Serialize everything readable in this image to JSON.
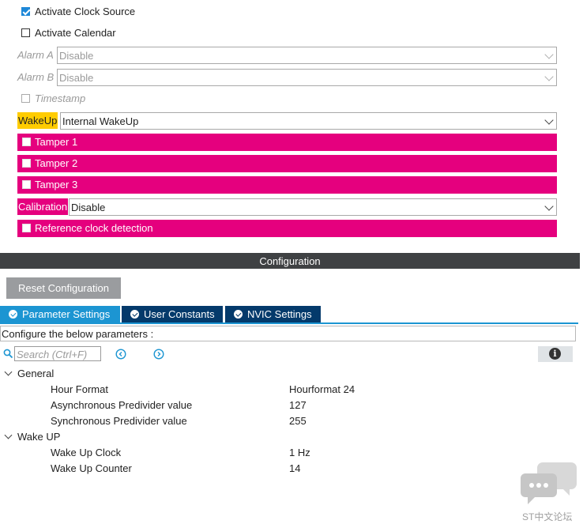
{
  "rtc_mode": {
    "activate_clock_source": {
      "label": "Activate Clock Source",
      "checked": true
    },
    "activate_calendar": {
      "label": "Activate Calendar",
      "checked": false
    },
    "alarm_a": {
      "label": "Alarm A",
      "value": "Disable"
    },
    "alarm_b": {
      "label": "Alarm B",
      "value": "Disable"
    },
    "timestamp": {
      "label": "Timestamp"
    },
    "wakeup": {
      "label": "WakeUp",
      "value": "Internal WakeUp"
    },
    "tampers": [
      "Tamper 1",
      "Tamper 2",
      "Tamper 3"
    ],
    "calibration": {
      "label": "Calibration",
      "value": "Disable"
    },
    "reference_clock": {
      "label": "Reference clock detection"
    }
  },
  "configuration": {
    "header": "Configuration",
    "reset_label": "Reset Configuration",
    "tabs": [
      {
        "label": "Parameter Settings",
        "active": true
      },
      {
        "label": "User Constants",
        "active": false
      },
      {
        "label": "NVIC Settings",
        "active": false
      }
    ],
    "instructions": "Configure the below parameters :",
    "search_placeholder": "Search (Ctrl+F)",
    "groups": [
      {
        "name": "General",
        "params": [
          {
            "name": "Hour Format",
            "value": "Hourformat 24"
          },
          {
            "name": "Asynchronous Predivider value",
            "value": "127"
          },
          {
            "name": "Synchronous Predivider value",
            "value": "255"
          }
        ]
      },
      {
        "name": "Wake UP",
        "params": [
          {
            "name": "Wake Up Clock",
            "value": "1 Hz"
          },
          {
            "name": "Wake Up Counter",
            "value": "14"
          }
        ]
      }
    ]
  },
  "watermark": {
    "text": "ST中文论坛"
  },
  "colors": {
    "pin_highlight": "#e5007e",
    "label_highlight": "#ffcc00",
    "tab_active": "#1c95d2",
    "tab_inactive": "#043a6b"
  }
}
